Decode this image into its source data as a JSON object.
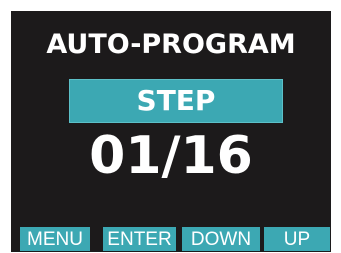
{
  "display": {
    "title": "AUTO-PROGRAM",
    "step_label": "STEP",
    "counter": "01/16"
  },
  "softkeys": [
    {
      "label": "MENU"
    },
    {
      "label": "ENTER"
    },
    {
      "label": "DOWN"
    },
    {
      "label": "UP"
    }
  ],
  "colors": {
    "screen_background": "#1c1a1b",
    "accent": "#3ca8b3",
    "text": "#ffffff"
  }
}
